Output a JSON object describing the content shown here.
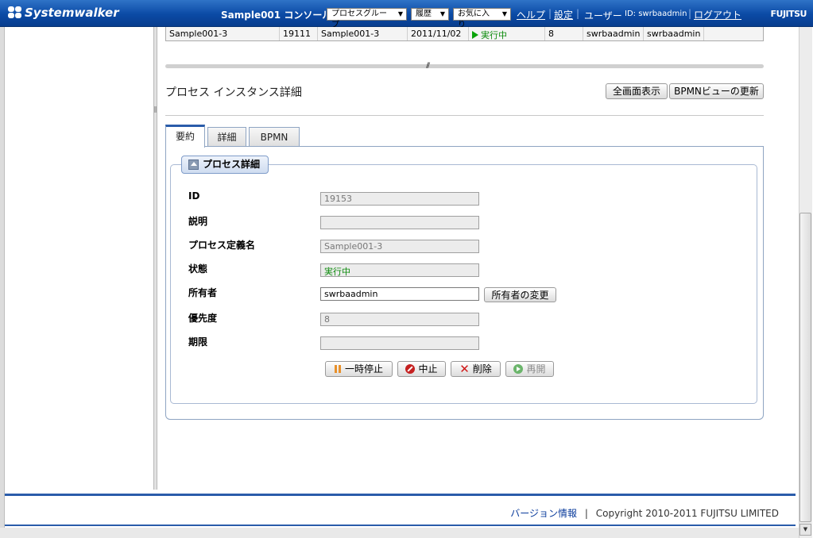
{
  "header": {
    "brand": "Systemwalker",
    "console_title": "Sample001 コンソール",
    "menus": [
      {
        "label": "プロセスグループ"
      },
      {
        "label": "履歴"
      },
      {
        "label": "お気に入り"
      }
    ],
    "help_link": "ヘルプ",
    "settings_link": "設定",
    "user_label": "ユーザー",
    "user_id": "ID: swrbaadmin",
    "logout_link": "ログアウト",
    "vendor": "FUJITSU"
  },
  "process_table": {
    "row": {
      "name": "Sample001-3",
      "id": "19111",
      "definition": "Sample001-3",
      "date": "2011/11/02",
      "status": "実行中",
      "priority": "8",
      "owner": "swrbaadmin",
      "initiator": "swrbaadmin"
    }
  },
  "detail": {
    "section_title": "プロセス インスタンス詳細",
    "fullscreen_button": "全画面表示",
    "refresh_bpmn_button": "BPMNビューの更新",
    "tabs": [
      {
        "label": "要約",
        "active": true
      },
      {
        "label": "詳細",
        "active": false
      },
      {
        "label": "BPMN",
        "active": false
      }
    ],
    "fieldset_title": "プロセス詳細",
    "fields": {
      "id": {
        "label": "ID",
        "value": "19153"
      },
      "description": {
        "label": "説明",
        "value": ""
      },
      "definition_name": {
        "label": "プロセス定義名",
        "value": "Sample001-3"
      },
      "state": {
        "label": "状態",
        "value": "実行中"
      },
      "owner": {
        "label": "所有者",
        "value": "swrbaadmin"
      },
      "priority": {
        "label": "優先度",
        "value": "8"
      },
      "due_date": {
        "label": "期限",
        "value": ""
      }
    },
    "change_owner_button": "所有者の変更",
    "actions": {
      "suspend": "一時停止",
      "abort": "中止",
      "delete": "削除",
      "resume": "再開"
    }
  },
  "footer": {
    "version_link": "バージョン情報",
    "separator": "|",
    "copyright": "Copyright 2010-2011 FUJITSU LIMITED"
  }
}
